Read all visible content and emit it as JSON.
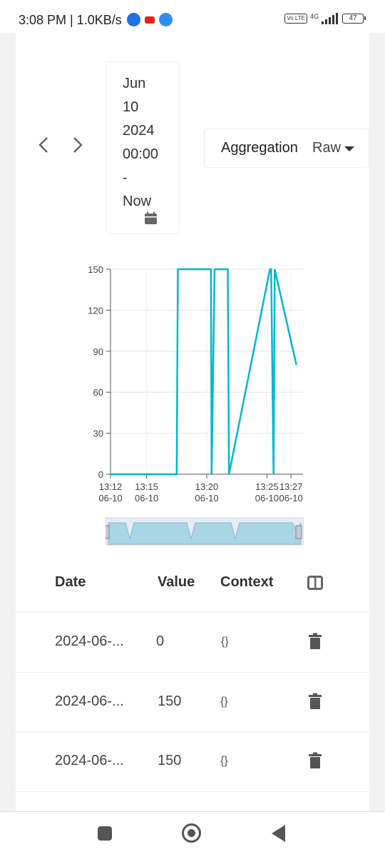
{
  "status_bar": {
    "time_speed": "3:08 PM | 1.0KB/s",
    "network": "4G",
    "volte": "Vo LTE",
    "battery": "47",
    "app_icons": [
      "phone-app-icon",
      "youtube-icon",
      "upload-icon"
    ]
  },
  "controls": {
    "prev_icon": "chevron-left-icon",
    "next_icon": "chevron-right-icon",
    "date_range": [
      "Jun",
      "10",
      "2024",
      "00:00",
      "-",
      "Now"
    ],
    "calendar_icon": "calendar-icon",
    "aggregation_label": "Aggregation",
    "aggregation_value": "Raw"
  },
  "chart_data": {
    "type": "line",
    "color": "#00b8cc",
    "y_ticks": [
      "150",
      "120",
      "90",
      "60",
      "30",
      "0"
    ],
    "ylim": [
      0,
      150
    ],
    "x_tick_labels": [
      {
        "time": "13:12",
        "date": "06-10"
      },
      {
        "time": "13:15",
        "date": "06-10"
      },
      {
        "time": "13:20",
        "date": "06-10"
      },
      {
        "time": "13:25",
        "date": "06-10"
      },
      {
        "time": "13:27",
        "date": "06-10"
      }
    ],
    "x_range": [
      "13:12",
      "13:28"
    ],
    "grid": true,
    "series": [
      {
        "x": [
          "13:12:00",
          "13:17:30",
          "13:17:36",
          "13:20:00",
          "13:20:21",
          "13:20:24",
          "13:20:39",
          "13:21:45",
          "13:21:51",
          "13:25:15",
          "13:25:21",
          "13:25:33",
          "13:25:39",
          "13:27:27"
        ],
        "y": [
          0,
          0,
          150,
          150,
          150,
          0,
          150,
          150,
          0,
          150,
          150,
          0,
          150,
          80
        ]
      }
    ]
  },
  "table": {
    "headers": {
      "date": "Date",
      "value": "Value",
      "context": "Context"
    },
    "columns_icon": "columns-icon",
    "rows": [
      {
        "date": "2024-06-...",
        "value": "0",
        "context": "{}"
      },
      {
        "date": "2024-06-...",
        "value": "150",
        "context": "{}"
      },
      {
        "date": "2024-06-...",
        "value": "150",
        "context": "{}"
      }
    ],
    "delete_icon": "trash-icon"
  },
  "android_nav": {
    "recents": "recents-icon",
    "home": "home-icon",
    "back": "back-icon"
  }
}
